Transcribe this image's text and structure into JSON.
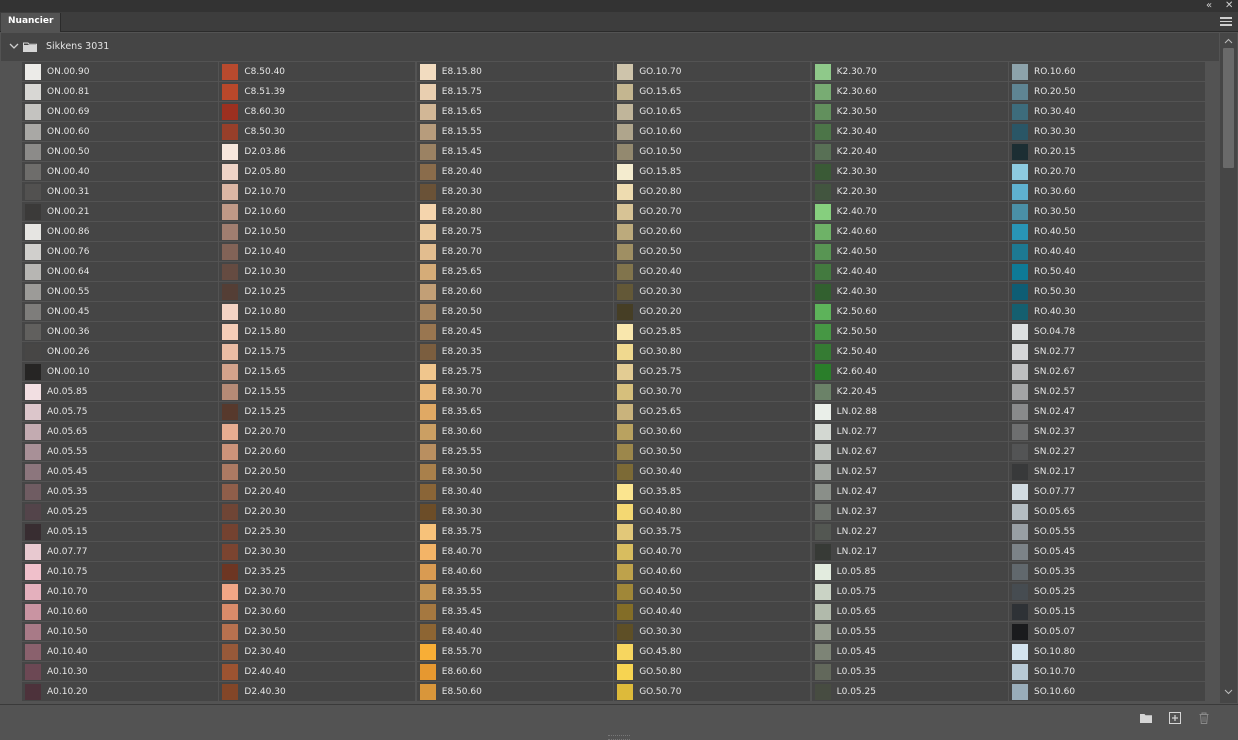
{
  "panel": {
    "tab_label": "Nuancier",
    "collapse_icon": "double-chevron-left-icon",
    "close_icon": "close-icon",
    "menu_icon": "hamburger-menu-icon"
  },
  "group": {
    "name": "Sikkens 3031",
    "expanded": true
  },
  "footer": {
    "new_group_icon": "folder-icon",
    "new_swatch_icon": "new-swatch-icon",
    "delete_icon": "trash-icon"
  },
  "columns": [
    [
      {
        "label": "ON.00.90",
        "color": "#ecebe8"
      },
      {
        "label": "ON.00.81",
        "color": "#d8d7d4"
      },
      {
        "label": "ON.00.69",
        "color": "#c4c3c0"
      },
      {
        "label": "ON.00.60",
        "color": "#a9a8a5"
      },
      {
        "label": "ON.00.50",
        "color": "#8c8b89"
      },
      {
        "label": "ON.00.40",
        "color": "#6e6d6b"
      },
      {
        "label": "ON.00.31",
        "color": "#525150"
      },
      {
        "label": "ON.00.21",
        "color": "#3b3a39"
      },
      {
        "label": "ON.00.86",
        "color": "#e6e5e2"
      },
      {
        "label": "ON.00.76",
        "color": "#d0cfcc"
      },
      {
        "label": "ON.00.64",
        "color": "#b7b6b3"
      },
      {
        "label": "ON.00.55",
        "color": "#9c9b98"
      },
      {
        "label": "ON.00.45",
        "color": "#7e7d7b"
      },
      {
        "label": "ON.00.36",
        "color": "#61605e"
      },
      {
        "label": "ON.00.26",
        "color": "#474645"
      },
      {
        "label": "ON.00.10",
        "color": "#262524"
      },
      {
        "label": "A0.05.85",
        "color": "#f2dfe2"
      },
      {
        "label": "A0.05.75",
        "color": "#dcc6cb"
      },
      {
        "label": "A0.05.65",
        "color": "#c3abb1"
      },
      {
        "label": "A0.05.55",
        "color": "#a89097"
      },
      {
        "label": "A0.05.45",
        "color": "#8c767d"
      },
      {
        "label": "A0.05.35",
        "color": "#6f5c62"
      },
      {
        "label": "A0.05.25",
        "color": "#53444a"
      },
      {
        "label": "A0.05.15",
        "color": "#382d31"
      },
      {
        "label": "A0.07.77",
        "color": "#e8c9d0"
      },
      {
        "label": "A0.10.75",
        "color": "#f0c0cb"
      },
      {
        "label": "A0.10.70",
        "color": "#e4b0bd"
      },
      {
        "label": "A0.10.60",
        "color": "#c994a2"
      },
      {
        "label": "A0.10.50",
        "color": "#a87a87"
      },
      {
        "label": "A0.10.40",
        "color": "#8a616d"
      },
      {
        "label": "A0.10.30",
        "color": "#6c4854"
      },
      {
        "label": "A0.10.20",
        "color": "#4d323b"
      }
    ],
    [
      {
        "label": "C8.50.40",
        "color": "#b84a2e"
      },
      {
        "label": "C8.51.39",
        "color": "#b9482b"
      },
      {
        "label": "C8.60.30",
        "color": "#9c3020"
      },
      {
        "label": "C8.50.30",
        "color": "#973f2a"
      },
      {
        "label": "D2.03.86",
        "color": "#f7e7dd"
      },
      {
        "label": "D2.05.80",
        "color": "#eed3c6"
      },
      {
        "label": "D2.10.70",
        "color": "#dcb6a4"
      },
      {
        "label": "D2.10.60",
        "color": "#c09987"
      },
      {
        "label": "D2.10.50",
        "color": "#a17e70"
      },
      {
        "label": "D2.10.40",
        "color": "#826357"
      },
      {
        "label": "D2.10.30",
        "color": "#654b41"
      },
      {
        "label": "D2.10.25",
        "color": "#543e35"
      },
      {
        "label": "D2.10.80",
        "color": "#f3d3c4"
      },
      {
        "label": "D2.15.80",
        "color": "#f5cdb7"
      },
      {
        "label": "D2.15.75",
        "color": "#eabca4"
      },
      {
        "label": "D2.15.65",
        "color": "#d3a28b"
      },
      {
        "label": "D2.15.55",
        "color": "#b58a76"
      },
      {
        "label": "D2.15.25",
        "color": "#57392c"
      },
      {
        "label": "D2.20.70",
        "color": "#e7ad91"
      },
      {
        "label": "D2.20.60",
        "color": "#cd937a"
      },
      {
        "label": "D2.20.50",
        "color": "#ad7a63"
      },
      {
        "label": "D2.20.40",
        "color": "#8f5e4a"
      },
      {
        "label": "D2.20.30",
        "color": "#6f4535"
      },
      {
        "label": "D2.25.30",
        "color": "#744230"
      },
      {
        "label": "D2.30.30",
        "color": "#7b4430"
      },
      {
        "label": "D2.35.25",
        "color": "#6d3623"
      },
      {
        "label": "D2.30.70",
        "color": "#f1a686"
      },
      {
        "label": "D2.30.60",
        "color": "#d98b6a"
      },
      {
        "label": "D2.30.50",
        "color": "#b7714f"
      },
      {
        "label": "D2.30.40",
        "color": "#975939"
      },
      {
        "label": "D2.40.40",
        "color": "#9c5331"
      },
      {
        "label": "D2.40.30",
        "color": "#834628"
      }
    ],
    [
      {
        "label": "E8.15.80",
        "color": "#f2dcc0"
      },
      {
        "label": "E8.15.75",
        "color": "#e9cfb0"
      },
      {
        "label": "E8.15.65",
        "color": "#d2b796"
      },
      {
        "label": "E8.15.55",
        "color": "#b79c7c"
      },
      {
        "label": "E8.15.45",
        "color": "#9b8263"
      },
      {
        "label": "E8.20.40",
        "color": "#8a6c4b"
      },
      {
        "label": "E8.20.30",
        "color": "#6a5237"
      },
      {
        "label": "E8.20.80",
        "color": "#f5d5ad"
      },
      {
        "label": "E8.20.75",
        "color": "#eccb9e"
      },
      {
        "label": "E8.20.70",
        "color": "#e2bd8f"
      },
      {
        "label": "E8.25.65",
        "color": "#d5ac78"
      },
      {
        "label": "E8.20.60",
        "color": "#c29f76"
      },
      {
        "label": "E8.20.50",
        "color": "#a7855e"
      },
      {
        "label": "E8.20.45",
        "color": "#997650"
      },
      {
        "label": "E8.20.35",
        "color": "#7b5e3f"
      },
      {
        "label": "E8.25.75",
        "color": "#f0c68d"
      },
      {
        "label": "E8.30.70",
        "color": "#e9b879"
      },
      {
        "label": "E8.35.65",
        "color": "#e0a964"
      },
      {
        "label": "E8.30.60",
        "color": "#cb9f63"
      },
      {
        "label": "E8.25.55",
        "color": "#b98f60"
      },
      {
        "label": "E8.30.50",
        "color": "#a9804b"
      },
      {
        "label": "E8.30.40",
        "color": "#8a6537"
      },
      {
        "label": "E8.30.30",
        "color": "#6c4d28"
      },
      {
        "label": "E8.35.75",
        "color": "#f7c27a"
      },
      {
        "label": "E8.40.70",
        "color": "#f3b467"
      },
      {
        "label": "E8.40.60",
        "color": "#d99b52"
      },
      {
        "label": "E8.35.55",
        "color": "#c49452"
      },
      {
        "label": "E8.35.45",
        "color": "#a57840"
      },
      {
        "label": "E8.40.40",
        "color": "#8d6533"
      },
      {
        "label": "E8.55.70",
        "color": "#f8ae36"
      },
      {
        "label": "E8.60.60",
        "color": "#e69830"
      },
      {
        "label": "E8.50.60",
        "color": "#d9963a"
      }
    ],
    [
      {
        "label": "GO.10.70",
        "color": "#cec4ab"
      },
      {
        "label": "GO.15.65",
        "color": "#c4b690"
      },
      {
        "label": "GO.10.65",
        "color": "#c0b59a"
      },
      {
        "label": "GO.10.60",
        "color": "#afa58c"
      },
      {
        "label": "GO.10.50",
        "color": "#93896f"
      },
      {
        "label": "GO.15.85",
        "color": "#f4eccf"
      },
      {
        "label": "GO.20.80",
        "color": "#eedcb0"
      },
      {
        "label": "GO.20.70",
        "color": "#d7c395"
      },
      {
        "label": "GO.20.60",
        "color": "#bcaa7c"
      },
      {
        "label": "GO.20.50",
        "color": "#9f8f63"
      },
      {
        "label": "GO.20.40",
        "color": "#81744c"
      },
      {
        "label": "GO.20.30",
        "color": "#635837"
      },
      {
        "label": "GO.20.20",
        "color": "#463e25"
      },
      {
        "label": "GO.25.85",
        "color": "#f9e7ad"
      },
      {
        "label": "GO.30.80",
        "color": "#f0d98f"
      },
      {
        "label": "GO.25.75",
        "color": "#e3cc93"
      },
      {
        "label": "GO.30.70",
        "color": "#d6bf7c"
      },
      {
        "label": "GO.25.65",
        "color": "#c9b37c"
      },
      {
        "label": "GO.30.60",
        "color": "#b9a260"
      },
      {
        "label": "GO.30.50",
        "color": "#9c874b"
      },
      {
        "label": "GO.30.40",
        "color": "#7c6a36"
      },
      {
        "label": "GO.35.85",
        "color": "#fbe58f"
      },
      {
        "label": "GO.40.80",
        "color": "#f4d872"
      },
      {
        "label": "GO.35.75",
        "color": "#e2c879"
      },
      {
        "label": "GO.40.70",
        "color": "#d8bd5f"
      },
      {
        "label": "GO.40.60",
        "color": "#bea24b"
      },
      {
        "label": "GO.40.50",
        "color": "#a08738"
      },
      {
        "label": "GO.40.40",
        "color": "#836d27"
      },
      {
        "label": "GO.30.30",
        "color": "#5e4f26"
      },
      {
        "label": "GO.45.80",
        "color": "#f7d65f"
      },
      {
        "label": "GO.50.80",
        "color": "#f7d451"
      },
      {
        "label": "GO.50.70",
        "color": "#ddba3a"
      }
    ],
    [
      {
        "label": "K2.30.70",
        "color": "#8fc98a"
      },
      {
        "label": "K2.30.60",
        "color": "#78ac73"
      },
      {
        "label": "K2.30.50",
        "color": "#62905d"
      },
      {
        "label": "K2.30.40",
        "color": "#4c7548"
      },
      {
        "label": "K2.20.40",
        "color": "#587055"
      },
      {
        "label": "K2.30.30",
        "color": "#3a5a36"
      },
      {
        "label": "K2.20.30",
        "color": "#42553f"
      },
      {
        "label": "K2.40.70",
        "color": "#86cf7e"
      },
      {
        "label": "K2.40.60",
        "color": "#6eb267"
      },
      {
        "label": "K2.40.50",
        "color": "#589553"
      },
      {
        "label": "K2.40.40",
        "color": "#437a3f"
      },
      {
        "label": "K2.40.30",
        "color": "#32602f"
      },
      {
        "label": "K2.50.60",
        "color": "#5db35a"
      },
      {
        "label": "K2.50.50",
        "color": "#469744"
      },
      {
        "label": "K2.50.40",
        "color": "#357b33"
      },
      {
        "label": "K2.60.40",
        "color": "#2a7e2a"
      },
      {
        "label": "K2.20.45",
        "color": "#6b8268"
      },
      {
        "label": "LN.02.88",
        "color": "#eaefe9"
      },
      {
        "label": "LN.02.77",
        "color": "#d3d8d2"
      },
      {
        "label": "LN.02.67",
        "color": "#bcc1bb"
      },
      {
        "label": "LN.02.57",
        "color": "#a3a8a2"
      },
      {
        "label": "LN.02.47",
        "color": "#8a8f89"
      },
      {
        "label": "LN.02.37",
        "color": "#6e736d"
      },
      {
        "label": "LN.02.27",
        "color": "#535752"
      },
      {
        "label": "LN.02.17",
        "color": "#373a36"
      },
      {
        "label": "L0.05.85",
        "color": "#e3ecdf"
      },
      {
        "label": "L0.05.75",
        "color": "#cad3c5"
      },
      {
        "label": "L0.05.65",
        "color": "#b1baab"
      },
      {
        "label": "L0.05.55",
        "color": "#989f91"
      },
      {
        "label": "L0.05.45",
        "color": "#7d8476"
      },
      {
        "label": "L0.05.35",
        "color": "#62685b"
      },
      {
        "label": "L0.05.25",
        "color": "#474c41"
      }
    ],
    [
      {
        "label": "RO.10.60",
        "color": "#8da3ab"
      },
      {
        "label": "RO.20.50",
        "color": "#5f8593"
      },
      {
        "label": "RO.30.40",
        "color": "#3d6c7c"
      },
      {
        "label": "RO.30.30",
        "color": "#2a5666"
      },
      {
        "label": "RO.20.15",
        "color": "#1c2e33"
      },
      {
        "label": "RO.20.70",
        "color": "#8ecbe0"
      },
      {
        "label": "RO.30.60",
        "color": "#5fb1cf"
      },
      {
        "label": "RO.30.50",
        "color": "#4a8fa6"
      },
      {
        "label": "RO.40.50",
        "color": "#2994b5"
      },
      {
        "label": "RO.40.40",
        "color": "#1d7992"
      },
      {
        "label": "RO.50.40",
        "color": "#0e7a96"
      },
      {
        "label": "RO.50.30",
        "color": "#0e5d74"
      },
      {
        "label": "RO.40.30",
        "color": "#155f6f"
      },
      {
        "label": "SO.04.78",
        "color": "#dde0e1"
      },
      {
        "label": "SN.02.77",
        "color": "#d6d7d8"
      },
      {
        "label": "SN.02.67",
        "color": "#bebfc0"
      },
      {
        "label": "SN.02.57",
        "color": "#a3a4a5"
      },
      {
        "label": "SN.02.47",
        "color": "#898a8b"
      },
      {
        "label": "SN.02.37",
        "color": "#6e6f70"
      },
      {
        "label": "SN.02.27",
        "color": "#535455"
      },
      {
        "label": "SN.02.17",
        "color": "#38393a"
      },
      {
        "label": "SO.07.77",
        "color": "#d2dce2"
      },
      {
        "label": "SO.05.65",
        "color": "#b4bdc2"
      },
      {
        "label": "SO.05.55",
        "color": "#989fa4"
      },
      {
        "label": "SO.05.45",
        "color": "#7c8388"
      },
      {
        "label": "SO.05.35",
        "color": "#61686d"
      },
      {
        "label": "SO.05.25",
        "color": "#464c51"
      },
      {
        "label": "SO.05.15",
        "color": "#2e3236"
      },
      {
        "label": "SO.05.07",
        "color": "#1a1b1d"
      },
      {
        "label": "SO.10.80",
        "color": "#d4e4ef"
      },
      {
        "label": "SO.10.70",
        "color": "#b7c9d5"
      },
      {
        "label": "SO.10.60",
        "color": "#99adba"
      }
    ]
  ]
}
